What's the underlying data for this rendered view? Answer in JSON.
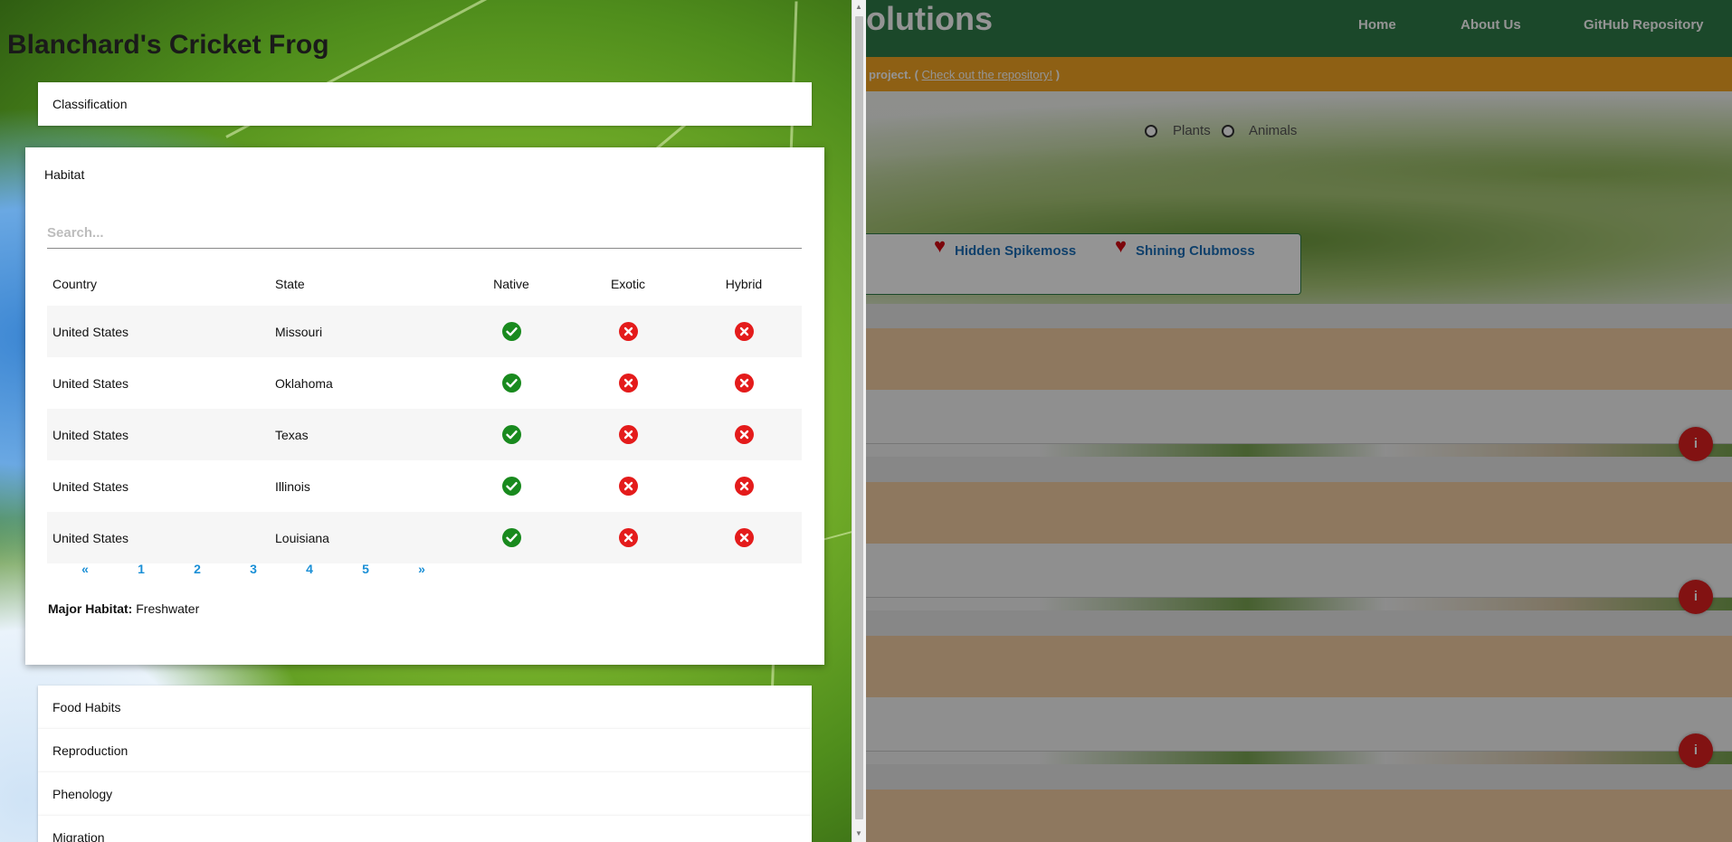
{
  "background_page": {
    "brand": "olutions",
    "nav": {
      "home": "Home",
      "about": "About Us",
      "github": "GitHub Repository"
    },
    "banner": {
      "text": "project. (",
      "link": "Check out the repository!",
      "suffix": ")"
    },
    "filters": {
      "plants": "Plants",
      "animals": "Animals"
    },
    "favorites": [
      {
        "label": "Hidden Spikemoss",
        "icon": "heart-icon"
      },
      {
        "label": "Shining Clubmoss",
        "icon": "heart-icon"
      }
    ],
    "info_icon": "i",
    "colors": {
      "navbar": "#2f7d49",
      "banner": "#f5a623",
      "favorite_link": "#1b6fb8",
      "heart": "#d60a14"
    }
  },
  "drawer": {
    "title": "Blanchard's Cricket Frog",
    "sections": {
      "classification": "Classification",
      "habitat": "Habitat",
      "food_habits": "Food Habits",
      "reproduction": "Reproduction",
      "phenology": "Phenology",
      "migration": "Migration"
    },
    "habitat": {
      "search_placeholder": "Search...",
      "columns": {
        "country": "Country",
        "state": "State",
        "native": "Native",
        "exotic": "Exotic",
        "hybrid": "Hybrid"
      },
      "rows": [
        {
          "country": "United States",
          "state": "Missouri",
          "native": true,
          "exotic": false,
          "hybrid": false
        },
        {
          "country": "United States",
          "state": "Oklahoma",
          "native": true,
          "exotic": false,
          "hybrid": false
        },
        {
          "country": "United States",
          "state": "Texas",
          "native": true,
          "exotic": false,
          "hybrid": false
        },
        {
          "country": "United States",
          "state": "Illinois",
          "native": true,
          "exotic": false,
          "hybrid": false
        },
        {
          "country": "United States",
          "state": "Louisiana",
          "native": true,
          "exotic": false,
          "hybrid": false
        }
      ],
      "pagination": [
        "«",
        "1",
        "2",
        "3",
        "4",
        "5",
        "»"
      ],
      "major_habitat_label": "Major Habitat:",
      "major_habitat_value": "Freshwater"
    },
    "icons": {
      "yes": "check-circle-icon",
      "no": "x-circle-icon"
    },
    "colors": {
      "check": "#198a1e",
      "cross": "#e41b1b",
      "page_link": "#1a8fd6"
    }
  }
}
